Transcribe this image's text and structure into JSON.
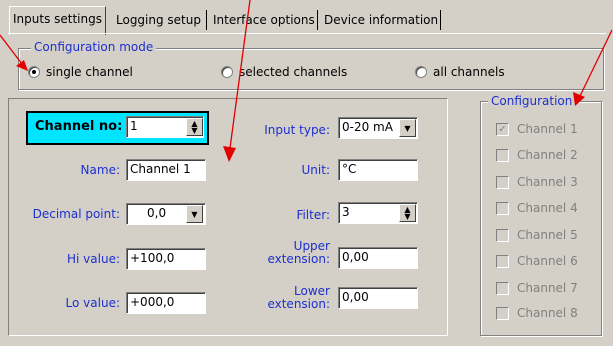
{
  "tabs": [
    {
      "label": "Inputs settings",
      "active": true
    },
    {
      "label": "Logging setup",
      "active": false
    },
    {
      "label": "Interface options",
      "active": false
    },
    {
      "label": "Device information",
      "active": false
    }
  ],
  "config_mode": {
    "title": "Configuration mode",
    "options": [
      {
        "label": "single channel",
        "selected": true
      },
      {
        "label": "selected channels",
        "selected": false
      },
      {
        "label": "all channels",
        "selected": false
      }
    ]
  },
  "channel": {
    "label": "Channel no:",
    "value": "1"
  },
  "fields": {
    "name": {
      "label": "Name:",
      "value": "Channel 1"
    },
    "decimal_point": {
      "label": "Decimal point:",
      "value": "0,0"
    },
    "hi_value": {
      "label": "Hi value:",
      "value": "+100,0"
    },
    "lo_value": {
      "label": "Lo value:",
      "value": "+000,0"
    },
    "input_type": {
      "label": "Input type:",
      "value": "0-20 mA"
    },
    "unit": {
      "label": "Unit:",
      "value": "°C"
    },
    "filter": {
      "label": "Filter:",
      "value": "3"
    },
    "upper_extension": {
      "label_line1": "Upper",
      "label_line2": "extension:",
      "value": "0,00"
    },
    "lower_extension": {
      "label_line1": "Lower",
      "label_line2": "extension:",
      "value": "0,00"
    }
  },
  "configuration": {
    "title": "Configuration",
    "channels": [
      {
        "label": "Channel 1",
        "checked": true
      },
      {
        "label": "Channel 2",
        "checked": false
      },
      {
        "label": "Channel 3",
        "checked": false
      },
      {
        "label": "Channel 4",
        "checked": false
      },
      {
        "label": "Channel 5",
        "checked": false
      },
      {
        "label": "Channel 6",
        "checked": false
      },
      {
        "label": "Channel 7",
        "checked": false
      },
      {
        "label": "Channel 8",
        "checked": false
      }
    ]
  },
  "colors": {
    "label_blue": "#1c2fd0",
    "channel_highlight": "#00e5ff",
    "arrow_red": "#e00000",
    "window_bg": "#d4d0c8"
  }
}
